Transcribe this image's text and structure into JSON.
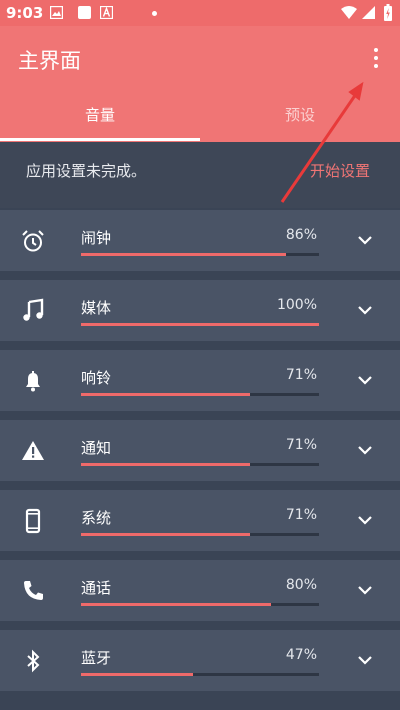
{
  "status": {
    "time": "9:03"
  },
  "appbar": {
    "title": "主界面"
  },
  "tabs": [
    {
      "label": "音量",
      "active": true
    },
    {
      "label": "预设",
      "active": false
    }
  ],
  "notice": {
    "text": "应用设置未完成。",
    "action": "开始设置"
  },
  "streams": [
    {
      "label": "闹钟",
      "percent": "86%",
      "level": 86,
      "icon": "alarm-clock-icon"
    },
    {
      "label": "媒体",
      "percent": "100%",
      "level": 100,
      "icon": "music-note-icon"
    },
    {
      "label": "响铃",
      "percent": "71%",
      "level": 71,
      "icon": "bell-icon"
    },
    {
      "label": "通知",
      "percent": "71%",
      "level": 71,
      "icon": "warning-icon"
    },
    {
      "label": "系统",
      "percent": "71%",
      "level": 71,
      "icon": "phone-device-icon"
    },
    {
      "label": "通话",
      "percent": "80%",
      "level": 80,
      "icon": "phone-call-icon"
    },
    {
      "label": "蓝牙",
      "percent": "47%",
      "level": 47,
      "icon": "bluetooth-icon"
    }
  ],
  "colors": {
    "accent": "#f07575",
    "background": "#3a4455",
    "row": "#4a5466"
  }
}
